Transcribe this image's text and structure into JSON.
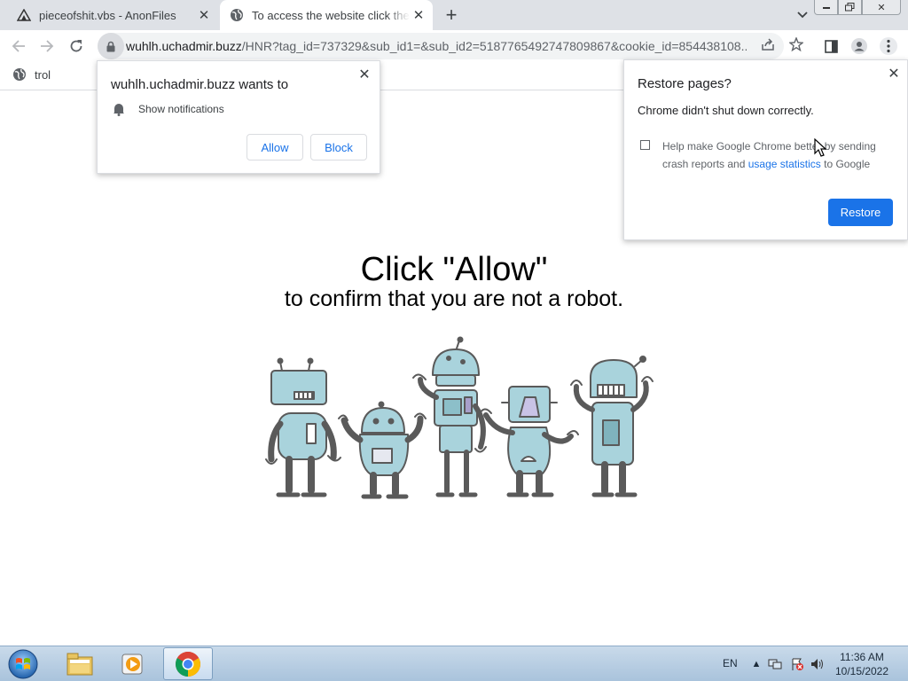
{
  "tabs": [
    {
      "title": "pieceofshit.vbs - AnonFiles",
      "icon": "anonfiles-icon"
    },
    {
      "title": "To access the website click the \"Allow\"",
      "icon": "globe-icon"
    }
  ],
  "toolbar": {
    "url_host": "wuhlh.uchadmir.buzz",
    "url_path": "/HNR?tag_id=737329&sub_id1=&sub_id2=5187765492747809867&cookie_id=854438108..."
  },
  "bookmarks": [
    {
      "label": "trol",
      "icon": "globe-icon"
    }
  ],
  "permission_prompt": {
    "title": "wuhlh.uchadmir.buzz wants to",
    "permission": "Show notifications",
    "allow_label": "Allow",
    "block_label": "Block",
    "close_glyph": "✕"
  },
  "restore_bubble": {
    "title": "Restore pages?",
    "message": "Chrome didn't shut down correctly.",
    "checkbox_text_1": "Help make Google Chrome better by sending crash reports and",
    "link_text": "usage statistics",
    "checkbox_text_2": "to Google",
    "restore_label": "Restore",
    "close_glyph": "✕"
  },
  "page": {
    "headline": "Click \"Allow\"",
    "subline": "to confirm that you are not a robot."
  },
  "taskbar": {
    "apps": [
      "windows-explorer",
      "media-player",
      "google-chrome"
    ],
    "language": "EN",
    "time": "11:36 AM",
    "date": "10/15/2022"
  },
  "colors": {
    "accent": "#1a73e8",
    "robot_fill": "#a9d3dc",
    "robot_stroke": "#5a5a5a"
  }
}
